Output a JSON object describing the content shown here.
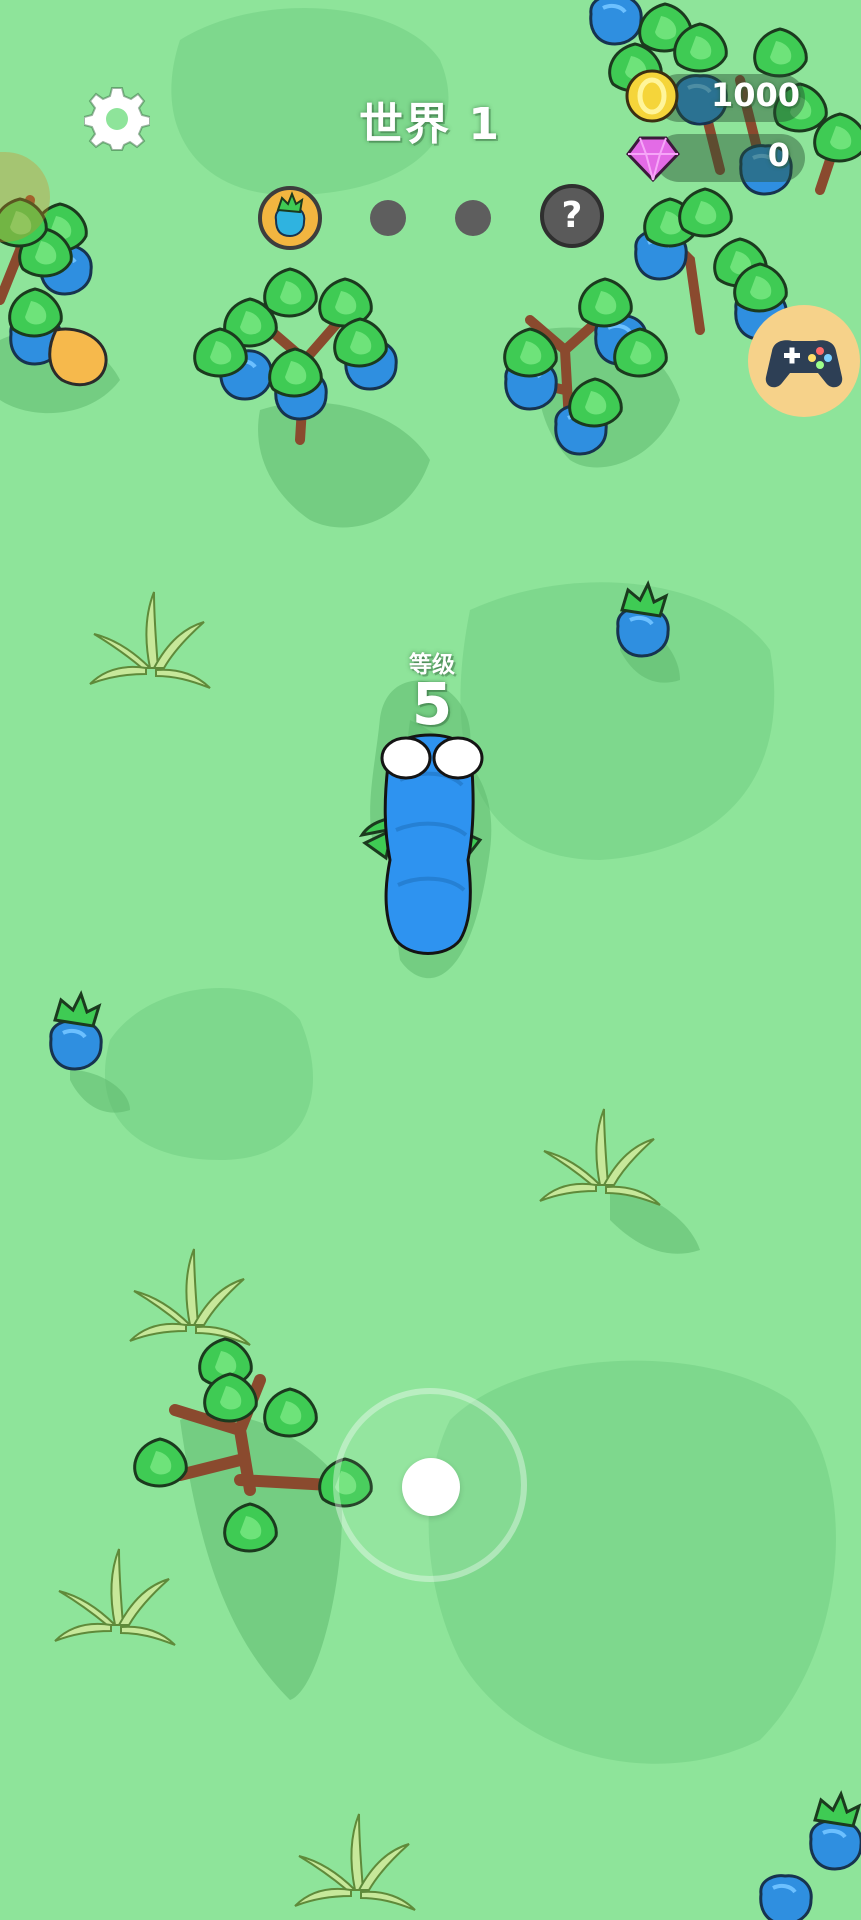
{
  "hud": {
    "world_title": "世界 1",
    "coins": "1000",
    "gems": "0",
    "unknown_stage_symbol": "?"
  },
  "player": {
    "level_label": "等级",
    "level_value": "5"
  },
  "icons": {
    "settings": "gear-icon",
    "coin": "coin-icon",
    "gem": "gem-icon",
    "gamepad": "gamepad-icon",
    "stage_complete": "berry-icon"
  },
  "colors": {
    "ground": "#8ee49a",
    "ground_patch": "#7bd68b",
    "foliage": "#3fcb54",
    "berry": "#2f8fe0",
    "player": "#2e93f0",
    "coin": "#f5d53a",
    "gem": "#e36be6",
    "gamepad_button": "#f6d28a"
  }
}
